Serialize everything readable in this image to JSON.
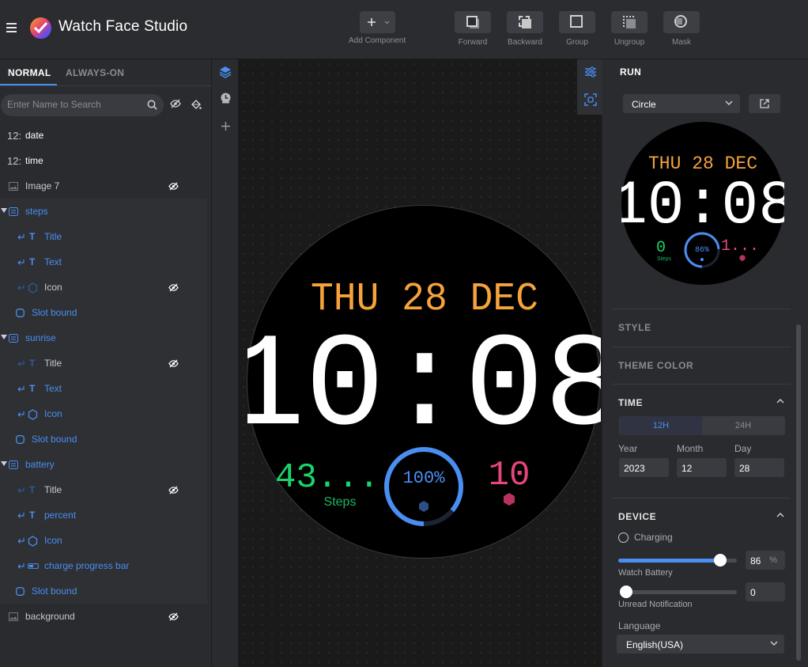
{
  "app": {
    "title": "Watch Face Studio",
    "menu_icon": "hamburger-icon",
    "logo_icon": "watch-face-studio-logo"
  },
  "toolbar": {
    "add_component": "Add Component",
    "forward": "Forward",
    "backward": "Backward",
    "group": "Group",
    "ungroup": "Ungroup",
    "mask": "Mask"
  },
  "left_panel": {
    "tabs": [
      {
        "label": "NORMAL",
        "active": true
      },
      {
        "label": "ALWAYS-ON",
        "active": false
      }
    ],
    "search_placeholder": "Enter Name to Search",
    "layers": [
      {
        "label": "date",
        "type_glyph": "12:",
        "icon": "digital-clock-icon"
      },
      {
        "label": "time",
        "type_glyph": "12:",
        "icon": "digital-clock-icon"
      },
      {
        "label": "Image 7",
        "icon": "image-icon",
        "hidden": true
      },
      {
        "label": "steps",
        "icon": "complication-group-icon",
        "group": true
      },
      {
        "label": "Title",
        "icon": "text-icon"
      },
      {
        "label": "Text",
        "icon": "text-icon"
      },
      {
        "label": "Icon",
        "icon": "hexagon-icon",
        "hidden": true
      },
      {
        "label": "Slot bound",
        "icon": "slot-bound-icon"
      },
      {
        "label": "sunrise",
        "icon": "complication-group-icon",
        "group": true
      },
      {
        "label": "Title",
        "icon": "text-icon",
        "hidden": true
      },
      {
        "label": "Text",
        "icon": "text-icon"
      },
      {
        "label": "Icon",
        "icon": "hexagon-icon"
      },
      {
        "label": "Slot bound",
        "icon": "slot-bound-icon"
      },
      {
        "label": "battery",
        "icon": "complication-group-icon",
        "group": true
      },
      {
        "label": "Title",
        "icon": "text-icon",
        "hidden": true
      },
      {
        "label": "percent",
        "icon": "text-icon"
      },
      {
        "label": "Icon",
        "icon": "hexagon-icon"
      },
      {
        "label": "charge progress bar",
        "icon": "progress-bar-icon"
      },
      {
        "label": "Slot bound",
        "icon": "slot-bound-icon"
      },
      {
        "label": "background",
        "icon": "image-icon",
        "hidden": true
      }
    ]
  },
  "watch_face": {
    "date": "THU 28 DEC",
    "time": "10:08",
    "steps_value": "43...",
    "steps_label": "Steps",
    "battery_percent": "100%",
    "battery_level": 1.0,
    "sunrise_value": "10",
    "colors": {
      "date": "#f6a33b",
      "steps": "#19d46a",
      "battery": "#4a8ef2",
      "sunrise": "#e8457a"
    }
  },
  "right_panel": {
    "run_label": "RUN",
    "shape_select": "Circle",
    "preview": {
      "date": "THU 28 DEC",
      "time": "10:08",
      "steps_value": "0",
      "steps_label": "Steps",
      "battery_percent": "86%",
      "battery_level": 0.86,
      "sunrise_value": "1..."
    },
    "sections": {
      "style": "STYLE",
      "theme_color": "THEME COLOR",
      "time": "TIME",
      "device": "DEVICE"
    },
    "time": {
      "h12": "12H",
      "h24": "24H",
      "year_label": "Year",
      "year": "2023",
      "month_label": "Month",
      "month": "12",
      "day_label": "Day",
      "day": "28"
    },
    "device": {
      "charging_label": "Charging",
      "watch_battery_label": "Watch Battery",
      "watch_battery": "86",
      "watch_battery_unit": "%",
      "watch_battery_level": 0.86,
      "unread_label": "Unread Notification",
      "unread": "0",
      "unread_level": 0,
      "language_label": "Language",
      "language": "English(USA)"
    }
  }
}
